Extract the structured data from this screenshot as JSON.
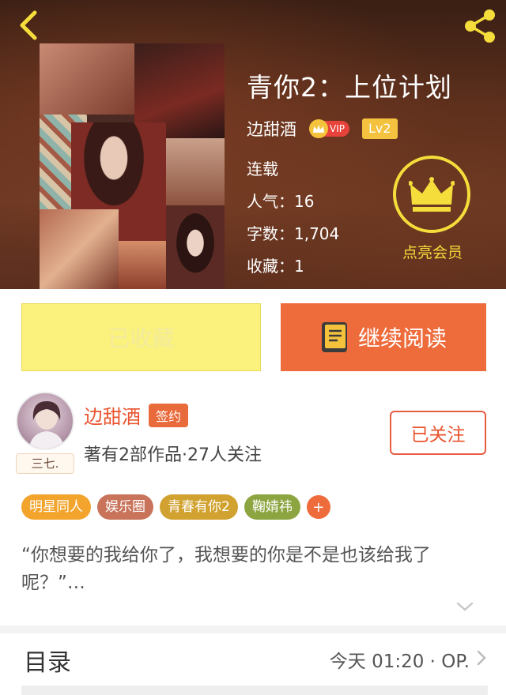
{
  "book": {
    "title": "青你2：上位计划",
    "author": "边甜酒",
    "vip_label": "VIP",
    "level_label": "Lv2",
    "status": "连载",
    "popularity": "人气：16",
    "word_count": "字数：1,704",
    "favorites": "收藏：1"
  },
  "member": {
    "label": "点亮会员"
  },
  "actions": {
    "collected_label": "已收藏",
    "continue_label": "继续阅读"
  },
  "author_card": {
    "name": "边甜酒",
    "sign_badge": "签约",
    "avatar_tag": "三七.",
    "meta": "著有2部作品·27人关注",
    "follow_label": "已关注"
  },
  "tags": [
    {
      "label": "明星同人",
      "color": "#f2a42c"
    },
    {
      "label": "娱乐圈",
      "color": "#c8735a"
    },
    {
      "label": "青春有你2",
      "color": "#d1a230"
    },
    {
      "label": "鞠婧祎",
      "color": "#8ca540"
    }
  ],
  "tag_add_label": "+",
  "intro": "“你想要的我给你了，我想要的你是不是也该给我了呢？”…",
  "toc": {
    "title": "目录",
    "update": "今天 01:20 · OP."
  },
  "colors": {
    "accent": "#ee6b3b",
    "gold": "#f5dd3b",
    "collected_bg": "#fbf27e"
  }
}
